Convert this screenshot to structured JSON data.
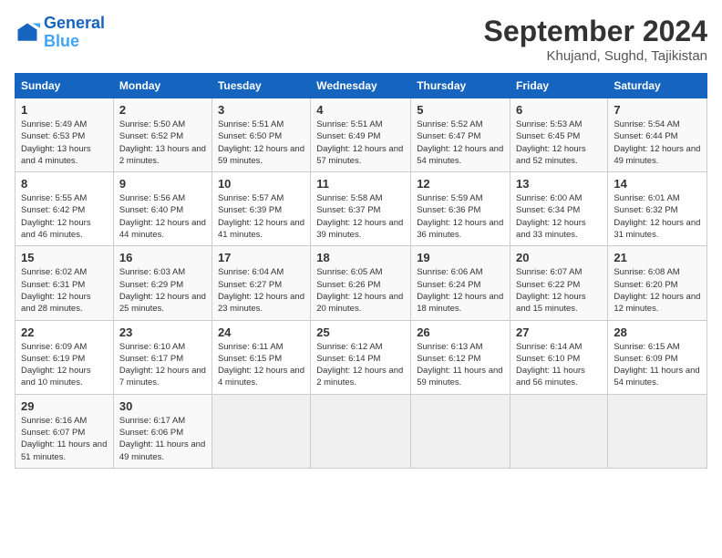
{
  "header": {
    "logo_line1": "General",
    "logo_line2": "Blue",
    "month_title": "September 2024",
    "location": "Khujand, Sughd, Tajikistan"
  },
  "weekdays": [
    "Sunday",
    "Monday",
    "Tuesday",
    "Wednesday",
    "Thursday",
    "Friday",
    "Saturday"
  ],
  "weeks": [
    [
      {
        "day": "1",
        "sunrise": "5:49 AM",
        "sunset": "6:53 PM",
        "daylight": "13 hours and 4 minutes."
      },
      {
        "day": "2",
        "sunrise": "5:50 AM",
        "sunset": "6:52 PM",
        "daylight": "13 hours and 2 minutes."
      },
      {
        "day": "3",
        "sunrise": "5:51 AM",
        "sunset": "6:50 PM",
        "daylight": "12 hours and 59 minutes."
      },
      {
        "day": "4",
        "sunrise": "5:51 AM",
        "sunset": "6:49 PM",
        "daylight": "12 hours and 57 minutes."
      },
      {
        "day": "5",
        "sunrise": "5:52 AM",
        "sunset": "6:47 PM",
        "daylight": "12 hours and 54 minutes."
      },
      {
        "day": "6",
        "sunrise": "5:53 AM",
        "sunset": "6:45 PM",
        "daylight": "12 hours and 52 minutes."
      },
      {
        "day": "7",
        "sunrise": "5:54 AM",
        "sunset": "6:44 PM",
        "daylight": "12 hours and 49 minutes."
      }
    ],
    [
      {
        "day": "8",
        "sunrise": "5:55 AM",
        "sunset": "6:42 PM",
        "daylight": "12 hours and 46 minutes."
      },
      {
        "day": "9",
        "sunrise": "5:56 AM",
        "sunset": "6:40 PM",
        "daylight": "12 hours and 44 minutes."
      },
      {
        "day": "10",
        "sunrise": "5:57 AM",
        "sunset": "6:39 PM",
        "daylight": "12 hours and 41 minutes."
      },
      {
        "day": "11",
        "sunrise": "5:58 AM",
        "sunset": "6:37 PM",
        "daylight": "12 hours and 39 minutes."
      },
      {
        "day": "12",
        "sunrise": "5:59 AM",
        "sunset": "6:36 PM",
        "daylight": "12 hours and 36 minutes."
      },
      {
        "day": "13",
        "sunrise": "6:00 AM",
        "sunset": "6:34 PM",
        "daylight": "12 hours and 33 minutes."
      },
      {
        "day": "14",
        "sunrise": "6:01 AM",
        "sunset": "6:32 PM",
        "daylight": "12 hours and 31 minutes."
      }
    ],
    [
      {
        "day": "15",
        "sunrise": "6:02 AM",
        "sunset": "6:31 PM",
        "daylight": "12 hours and 28 minutes."
      },
      {
        "day": "16",
        "sunrise": "6:03 AM",
        "sunset": "6:29 PM",
        "daylight": "12 hours and 25 minutes."
      },
      {
        "day": "17",
        "sunrise": "6:04 AM",
        "sunset": "6:27 PM",
        "daylight": "12 hours and 23 minutes."
      },
      {
        "day": "18",
        "sunrise": "6:05 AM",
        "sunset": "6:26 PM",
        "daylight": "12 hours and 20 minutes."
      },
      {
        "day": "19",
        "sunrise": "6:06 AM",
        "sunset": "6:24 PM",
        "daylight": "12 hours and 18 minutes."
      },
      {
        "day": "20",
        "sunrise": "6:07 AM",
        "sunset": "6:22 PM",
        "daylight": "12 hours and 15 minutes."
      },
      {
        "day": "21",
        "sunrise": "6:08 AM",
        "sunset": "6:20 PM",
        "daylight": "12 hours and 12 minutes."
      }
    ],
    [
      {
        "day": "22",
        "sunrise": "6:09 AM",
        "sunset": "6:19 PM",
        "daylight": "12 hours and 10 minutes."
      },
      {
        "day": "23",
        "sunrise": "6:10 AM",
        "sunset": "6:17 PM",
        "daylight": "12 hours and 7 minutes."
      },
      {
        "day": "24",
        "sunrise": "6:11 AM",
        "sunset": "6:15 PM",
        "daylight": "12 hours and 4 minutes."
      },
      {
        "day": "25",
        "sunrise": "6:12 AM",
        "sunset": "6:14 PM",
        "daylight": "12 hours and 2 minutes."
      },
      {
        "day": "26",
        "sunrise": "6:13 AM",
        "sunset": "6:12 PM",
        "daylight": "11 hours and 59 minutes."
      },
      {
        "day": "27",
        "sunrise": "6:14 AM",
        "sunset": "6:10 PM",
        "daylight": "11 hours and 56 minutes."
      },
      {
        "day": "28",
        "sunrise": "6:15 AM",
        "sunset": "6:09 PM",
        "daylight": "11 hours and 54 minutes."
      }
    ],
    [
      {
        "day": "29",
        "sunrise": "6:16 AM",
        "sunset": "6:07 PM",
        "daylight": "11 hours and 51 minutes."
      },
      {
        "day": "30",
        "sunrise": "6:17 AM",
        "sunset": "6:06 PM",
        "daylight": "11 hours and 49 minutes."
      },
      null,
      null,
      null,
      null,
      null
    ]
  ],
  "labels": {
    "sunrise": "Sunrise:",
    "sunset": "Sunset:",
    "daylight": "Daylight hours"
  }
}
